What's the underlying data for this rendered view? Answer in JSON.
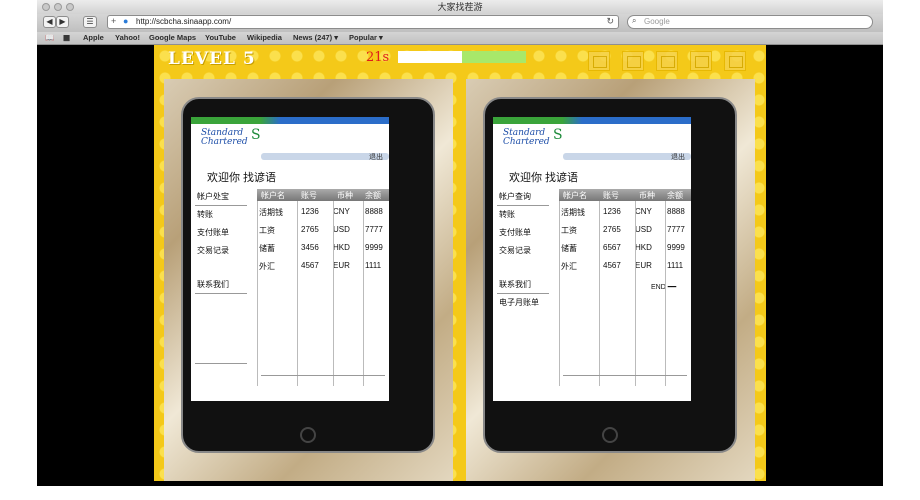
{
  "window": {
    "title": "大家找茬游"
  },
  "toolbar": {
    "back": "◀",
    "forward": "▶",
    "url": "http://scbcha.sinaapp.com/",
    "reload_icon": "reload-icon",
    "search_placeholder": "Google"
  },
  "bookmarks": [
    "Apple",
    "Yahoo!",
    "Google Maps",
    "YouTube",
    "Wikipedia",
    "News (247) ▾",
    "Popular ▾"
  ],
  "game": {
    "level": "LEVEL 5",
    "timer": "21s",
    "progress": 0.5
  },
  "left": {
    "logo": [
      "Standard",
      "Chartered"
    ],
    "top_link": "退出",
    "welcome": "欢迎你 找谚语",
    "menu": [
      "帐户处宝",
      "转账",
      "支付账单",
      "交易记录",
      "联系我们"
    ],
    "table_headers": [
      "帐户名",
      "账号",
      "币种",
      "余额"
    ],
    "rows": [
      [
        "活期钱",
        "1236",
        "CNY",
        "8888"
      ],
      [
        "工资",
        "2765",
        "USD",
        "7777"
      ],
      [
        "储蓄",
        "3456",
        "HKD",
        "9999"
      ],
      [
        "外汇",
        "4567",
        "EUR",
        "1111"
      ]
    ],
    "extra_menu": null,
    "footer_link": null
  },
  "right": {
    "logo": [
      "Standard",
      "Chartered"
    ],
    "top_link": "退出",
    "welcome": "欢迎你 找谚语",
    "menu": [
      "帐户查询",
      "转账",
      "支付账单",
      "交易记录",
      "联系我们"
    ],
    "table_headers": [
      "帐户名",
      "账号",
      "币种",
      "余额"
    ],
    "rows": [
      [
        "活期钱",
        "1236",
        "CNY",
        "8888"
      ],
      [
        "工资",
        "2765",
        "USD",
        "7777"
      ],
      [
        "储蓄",
        "6567",
        "HKD",
        "9999"
      ],
      [
        "外汇",
        "4567",
        "EUR",
        "1111"
      ]
    ],
    "extra_menu": "电子月账单",
    "footer_link": "END ━━"
  }
}
